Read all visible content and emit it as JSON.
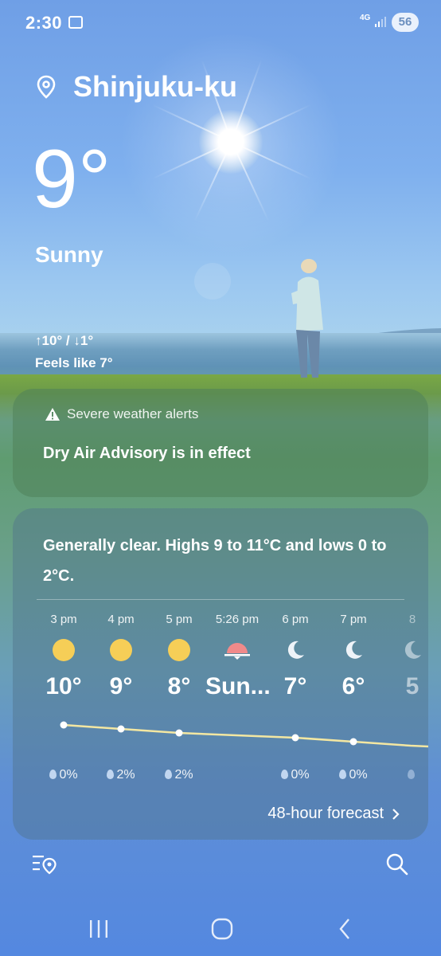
{
  "status_bar": {
    "time": "2:30",
    "network": "4G",
    "battery": "56"
  },
  "current": {
    "location": "Shinjuku-ku",
    "temperature": "9°",
    "condition": "Sunny",
    "high_low": "↑10° / ↓1°",
    "feels_like": "Feels like 7°"
  },
  "alert": {
    "header": "Severe weather alerts",
    "message": "Dry Air Advisory is in effect"
  },
  "forecast": {
    "summary": "Generally clear. Highs 9 to 11°C and lows 0 to 2°C.",
    "hours": [
      {
        "time": "3 pm",
        "icon": "sun-icon",
        "temp": "10°",
        "precip": "0%"
      },
      {
        "time": "4 pm",
        "icon": "sun-icon",
        "temp": "9°",
        "precip": "2%"
      },
      {
        "time": "5 pm",
        "icon": "sun-icon",
        "temp": "8°",
        "precip": "2%"
      },
      {
        "time": "5:26 pm",
        "icon": "sunset-icon",
        "temp": "Sun...",
        "precip": ""
      },
      {
        "time": "6 pm",
        "icon": "moon-icon",
        "temp": "7°",
        "precip": "0%"
      },
      {
        "time": "7 pm",
        "icon": "moon-icon",
        "temp": "6°",
        "precip": "0%"
      },
      {
        "time": "8",
        "icon": "moon-icon",
        "temp": "5",
        "precip": ""
      }
    ],
    "link": "48-hour forecast"
  },
  "colors": {
    "sun": "#f6ce57",
    "sunset": "#f08a8a",
    "trend_line": "#f3e7a2"
  },
  "icons": [
    "location-pin-icon",
    "warning-icon",
    "chevron-right-icon",
    "location-list-icon",
    "search-icon",
    "recent-apps-icon",
    "home-icon",
    "back-icon"
  ]
}
